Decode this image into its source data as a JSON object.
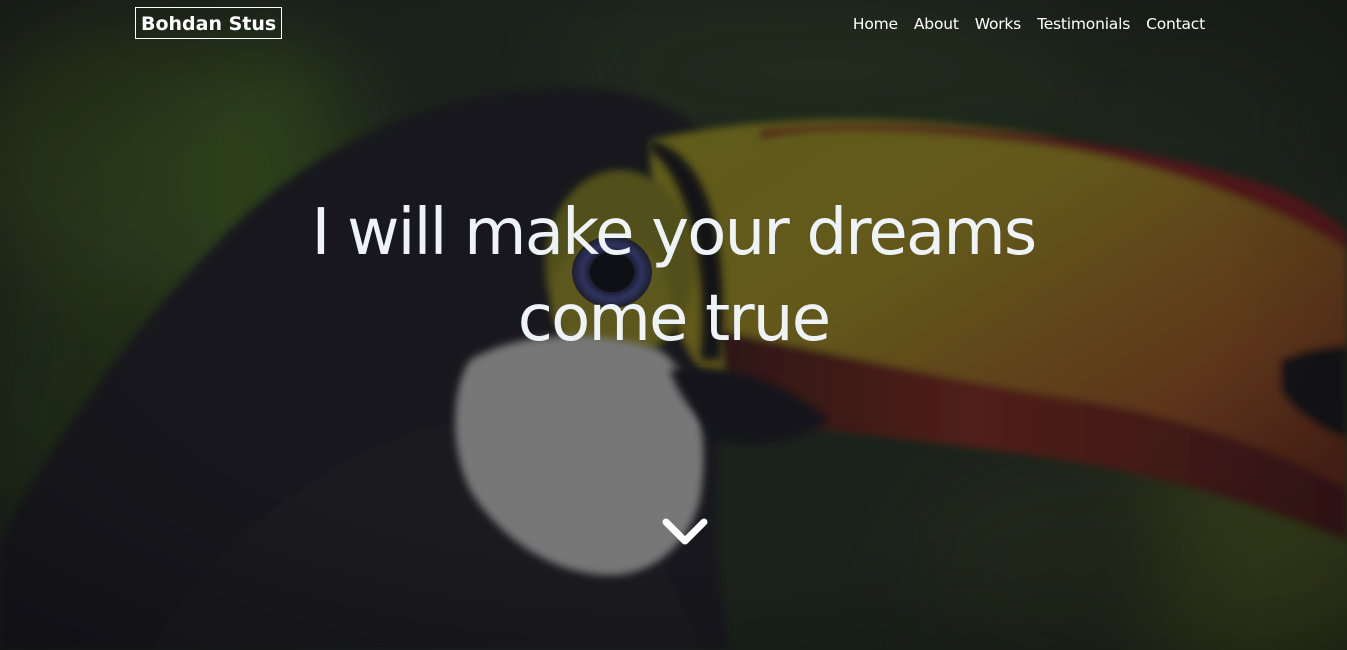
{
  "brand": {
    "name": "Bohdan Stus"
  },
  "nav": {
    "items": [
      {
        "label": "Home"
      },
      {
        "label": "About"
      },
      {
        "label": "Works"
      },
      {
        "label": "Testimonials"
      },
      {
        "label": "Contact"
      }
    ]
  },
  "hero": {
    "headline_line1": "I will make your dreams",
    "headline_line2": "come true",
    "background_image": "toucan-photo",
    "scroll_icon": "chevron-down-icon"
  },
  "colors": {
    "text": "#ffffff",
    "headline": "#eef3f8",
    "overlay": "#14161a"
  }
}
